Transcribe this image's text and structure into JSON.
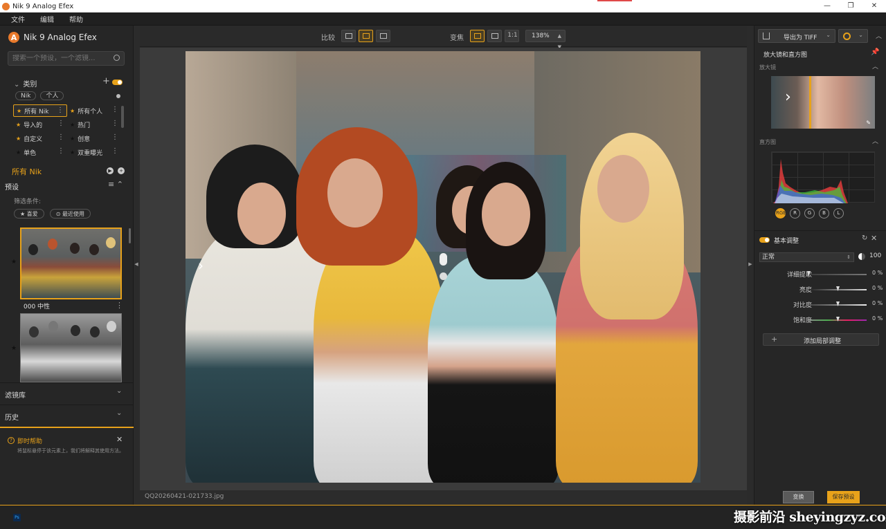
{
  "window": {
    "title": "Nik 9 Analog Efex",
    "controls": [
      "—",
      "❐",
      "✕"
    ]
  },
  "menu": [
    "文件",
    "编辑",
    "帮助"
  ],
  "left": {
    "brand": "Nik 9 Analog Efex",
    "search_placeholder": "搜索一个预设，一个滤镜...",
    "categories_label": "类别",
    "chips": [
      "Nik",
      "个人"
    ],
    "categories": [
      {
        "label": "所有 Nik",
        "star": "gold",
        "active": true
      },
      {
        "label": "所有个人",
        "star": "gold"
      },
      {
        "label": "导入的",
        "star": "gold"
      },
      {
        "label": "热门",
        "star": "dark"
      },
      {
        "label": "自定义",
        "star": "gold"
      },
      {
        "label": "创意",
        "star": "dark"
      },
      {
        "label": "单色",
        "star": "dark"
      },
      {
        "label": "双重曝光",
        "star": "dark"
      }
    ],
    "all_nik": "所有 Nik",
    "presets_label": "预设",
    "filter_label": "筛选条件:",
    "filter_chips": [
      "★ 喜爱",
      "⊙ 最近使用"
    ],
    "preset_name": "000 中性",
    "filters_section": "滤镜库",
    "history_section": "历史",
    "help": {
      "title": "即时帮助",
      "text": "将鼠标悬停于该元素上，我们将解释其使用方法。"
    }
  },
  "center": {
    "compare_label": "比较",
    "zoom_label": "变焦",
    "zoom_1to1": "1:1",
    "zoom_value": "138%",
    "filename": "QQ20260421-021733.jpg"
  },
  "right": {
    "export_label": "导出为 TIFF",
    "loupe_section": "放大镜和直方图",
    "loupe_label": "放大镜",
    "histogram_label": "直方图",
    "channels": [
      "RGB",
      "R",
      "G",
      "B",
      "L"
    ],
    "basic_title": "基本调整",
    "blend_mode": "正常",
    "opacity": "100",
    "sliders": [
      {
        "label": "详细提取",
        "value": "0 %"
      },
      {
        "label": "亮度",
        "value": "0 %"
      },
      {
        "label": "对比度",
        "value": "0 %"
      },
      {
        "label": "饱和度",
        "value": "0 %"
      }
    ],
    "add_local": "添加局部调整",
    "shuffle_btn": "变换",
    "save_preset_btn": "保存预设"
  },
  "watermark": "摄影前沿 sheyingzyz.com",
  "colors": {
    "accent": "#e8a21a",
    "panel": "#262626",
    "canvas": "#3b3b3b"
  }
}
